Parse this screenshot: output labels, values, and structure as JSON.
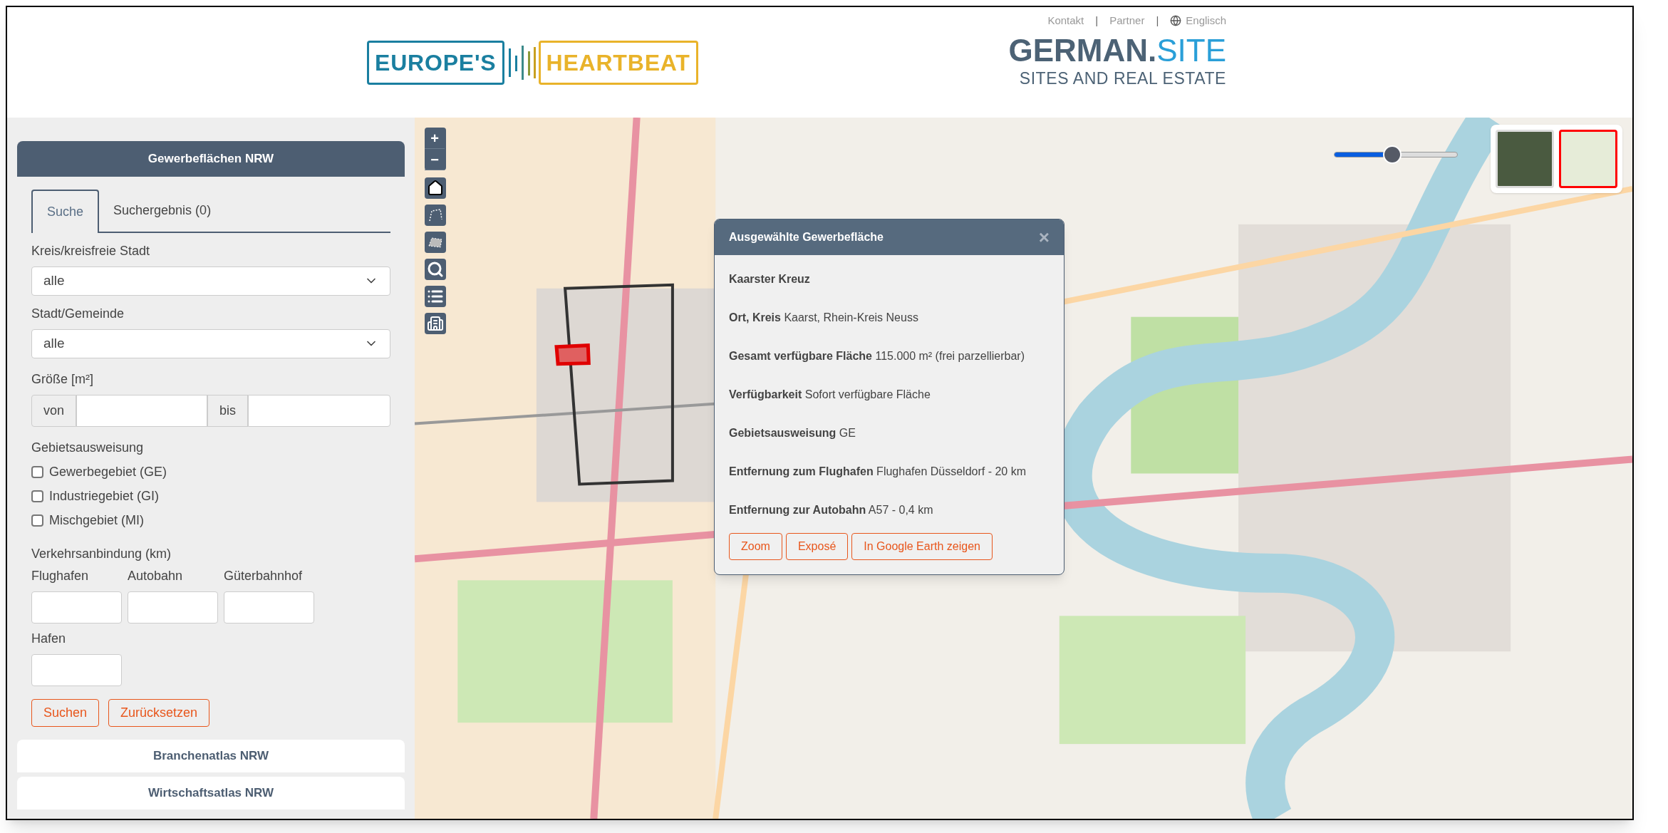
{
  "header": {
    "top_links": [
      {
        "label": "Kontakt",
        "kind": "text"
      },
      {
        "label": "|",
        "kind": "separator"
      },
      {
        "label": "Partner",
        "kind": "text"
      },
      {
        "label": "|",
        "kind": "separator"
      },
      {
        "label": "Englisch",
        "kind": "globe"
      }
    ],
    "left_logo": {
      "part_1": "EUROPE'S",
      "part_2": "HEARTBEAT"
    },
    "right_logo": {
      "part_1": "GERMAN.",
      "part_2": "SITE",
      "tagline": "SITES AND REAL ESTATE"
    }
  },
  "sidebar": {
    "title": "Gewerbeflächen NRW",
    "tabs": [
      {
        "label": "Suche",
        "selected": true
      },
      {
        "label": "Suchergebnis (0)",
        "selected": false
      }
    ],
    "selects": [
      {
        "label": "Kreis/kreisfreie Stadt",
        "value": "alle"
      },
      {
        "label": "Stadt/Gemeinde",
        "value": "alle"
      }
    ],
    "size": {
      "label": "Größe [m²]",
      "from": "von",
      "to": "bis"
    },
    "zoning": {
      "label": "Gebietsausweisung",
      "options": [
        {
          "label": "Gewerbegebiet (GE)",
          "checked": false
        },
        {
          "label": "Industriegebiet (GI)",
          "checked": false
        },
        {
          "label": "Mischgebiet (MI)",
          "checked": false
        }
      ]
    },
    "transport": {
      "label": "Verkehrsanbindung (km)",
      "fields": [
        "Flughafen",
        "Autobahn",
        "Güterbahnhof",
        "Hafen"
      ]
    },
    "buttons": [
      "Suchen",
      "Zurücksetzen"
    ],
    "sections": [
      "Branchenatlas NRW",
      "Wirtschaftsatlas NRW"
    ]
  },
  "map": {
    "zoom": [
      "+",
      "−"
    ],
    "tools": [
      {
        "kind": "home"
      },
      {
        "kind": "polygon"
      },
      {
        "kind": "area"
      },
      {
        "kind": "search"
      },
      {
        "kind": "list"
      },
      {
        "kind": "building"
      }
    ],
    "opacity_slider": {
      "level": 0.47
    },
    "layers": [
      {
        "kind": "satellite",
        "selected": false
      },
      {
        "kind": "street",
        "selected": true
      }
    ],
    "popup": {
      "title": "Ausgewählte Gewerbefläche",
      "close": "×",
      "name": "Kaarster Kreuz",
      "rows": [
        {
          "label": "Ort, Kreis",
          "value": "Kaarst, Rhein-Kreis Neuss"
        },
        {
          "label": "Gesamt verfügbare Fläche",
          "value": "115.000 m² (frei parzellierbar)"
        },
        {
          "label": "Verfügbarkeit",
          "value": "Sofort verfügbare Fläche"
        },
        {
          "label": "Gebietsausweisung",
          "value": "GE"
        },
        {
          "label": "Entfernung zum Flughafen",
          "value": "Flughafen Düsseldorf - 20 km"
        },
        {
          "label": "Entfernung zur Autobahn",
          "value": "A57 - 0,4 km"
        }
      ],
      "buttons": [
        "Zoom",
        "Exposé",
        "In Google Earth zeigen"
      ]
    }
  }
}
